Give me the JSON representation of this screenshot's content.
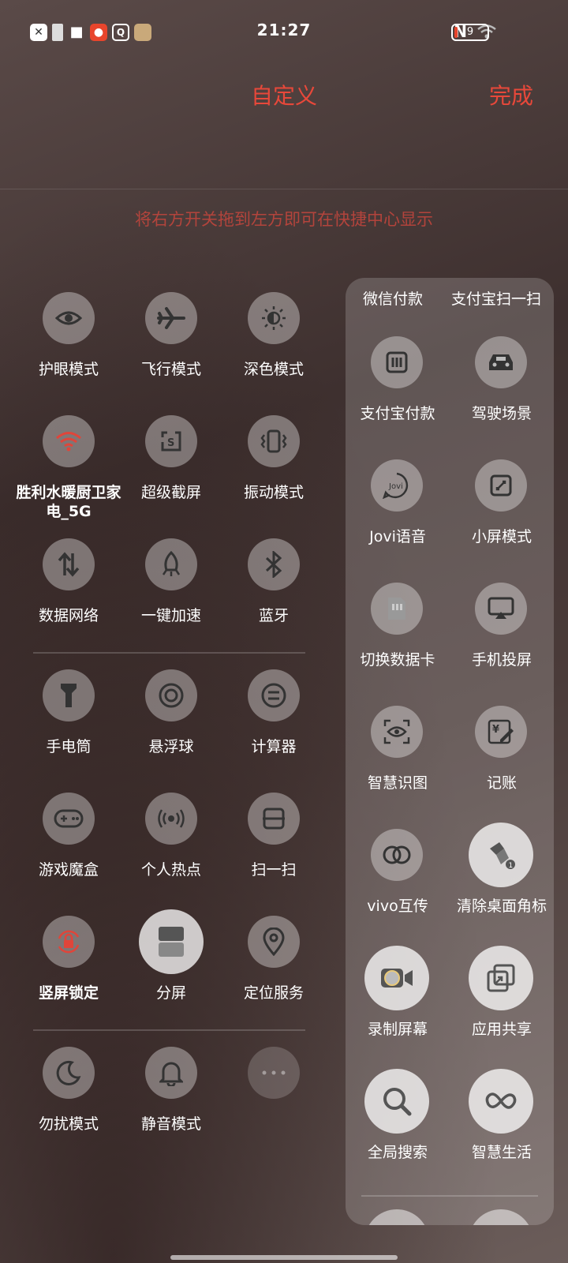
{
  "status": {
    "time": "21:27",
    "battery": "9",
    "nfc": "N"
  },
  "header": {
    "title": "自定义",
    "done": "完成",
    "hint": "将右方开关拖到左方即可在快捷中心显示"
  },
  "left_tiles": [
    {
      "label": "护眼模式",
      "icon": "eye-icon"
    },
    {
      "label": "飞行模式",
      "icon": "airplane-icon"
    },
    {
      "label": "深色模式",
      "icon": "dark-mode-icon"
    },
    {
      "label": "胜利水暖厨卫家电_5G",
      "icon": "wifi-icon"
    },
    {
      "label": "超级截屏",
      "icon": "screenshot-icon"
    },
    {
      "label": "振动模式",
      "icon": "vibrate-icon"
    },
    {
      "label": "数据网络",
      "icon": "data-network-icon"
    },
    {
      "label": "一键加速",
      "icon": "rocket-icon"
    },
    {
      "label": "蓝牙",
      "icon": "bluetooth-icon"
    },
    {
      "label": "手电筒",
      "icon": "flashlight-icon"
    },
    {
      "label": "悬浮球",
      "icon": "floating-ball-icon"
    },
    {
      "label": "计算器",
      "icon": "calculator-icon"
    },
    {
      "label": "游戏魔盒",
      "icon": "gamepad-icon"
    },
    {
      "label": "个人热点",
      "icon": "hotspot-icon"
    },
    {
      "label": "扫一扫",
      "icon": "scan-icon"
    },
    {
      "label": "竖屏锁定",
      "icon": "rotation-lock-icon"
    },
    {
      "label": "分屏",
      "icon": "split-screen-icon"
    },
    {
      "label": "定位服务",
      "icon": "location-icon"
    },
    {
      "label": "勿扰模式",
      "icon": "moon-icon"
    },
    {
      "label": "静音模式",
      "icon": "bell-icon"
    }
  ],
  "right_top": [
    "微信付款",
    "支付宝扫一扫"
  ],
  "right_tiles": [
    {
      "label": "支付宝付款",
      "icon": "alipay-pay-icon"
    },
    {
      "label": "驾驶场景",
      "icon": "car-icon"
    },
    {
      "label": "Jovi语音",
      "icon": "jovi-icon"
    },
    {
      "label": "小屏模式",
      "icon": "small-screen-icon"
    },
    {
      "label": "切换数据卡",
      "icon": "sim-card-icon"
    },
    {
      "label": "手机投屏",
      "icon": "cast-icon"
    },
    {
      "label": "智慧识图",
      "icon": "smart-vision-icon"
    },
    {
      "label": "记账",
      "icon": "bookkeeping-icon"
    },
    {
      "label": "vivo互传",
      "icon": "vivo-share-icon"
    },
    {
      "label": "清除桌面角标",
      "icon": "clear-badge-icon"
    },
    {
      "label": "录制屏幕",
      "icon": "screen-record-icon"
    },
    {
      "label": "应用共享",
      "icon": "app-share-icon"
    },
    {
      "label": "全局搜索",
      "icon": "search-icon"
    },
    {
      "label": "智慧生活",
      "icon": "smart-life-icon"
    }
  ],
  "colors": {
    "accent": "#e8483a",
    "active_icon": "#e0453a"
  }
}
